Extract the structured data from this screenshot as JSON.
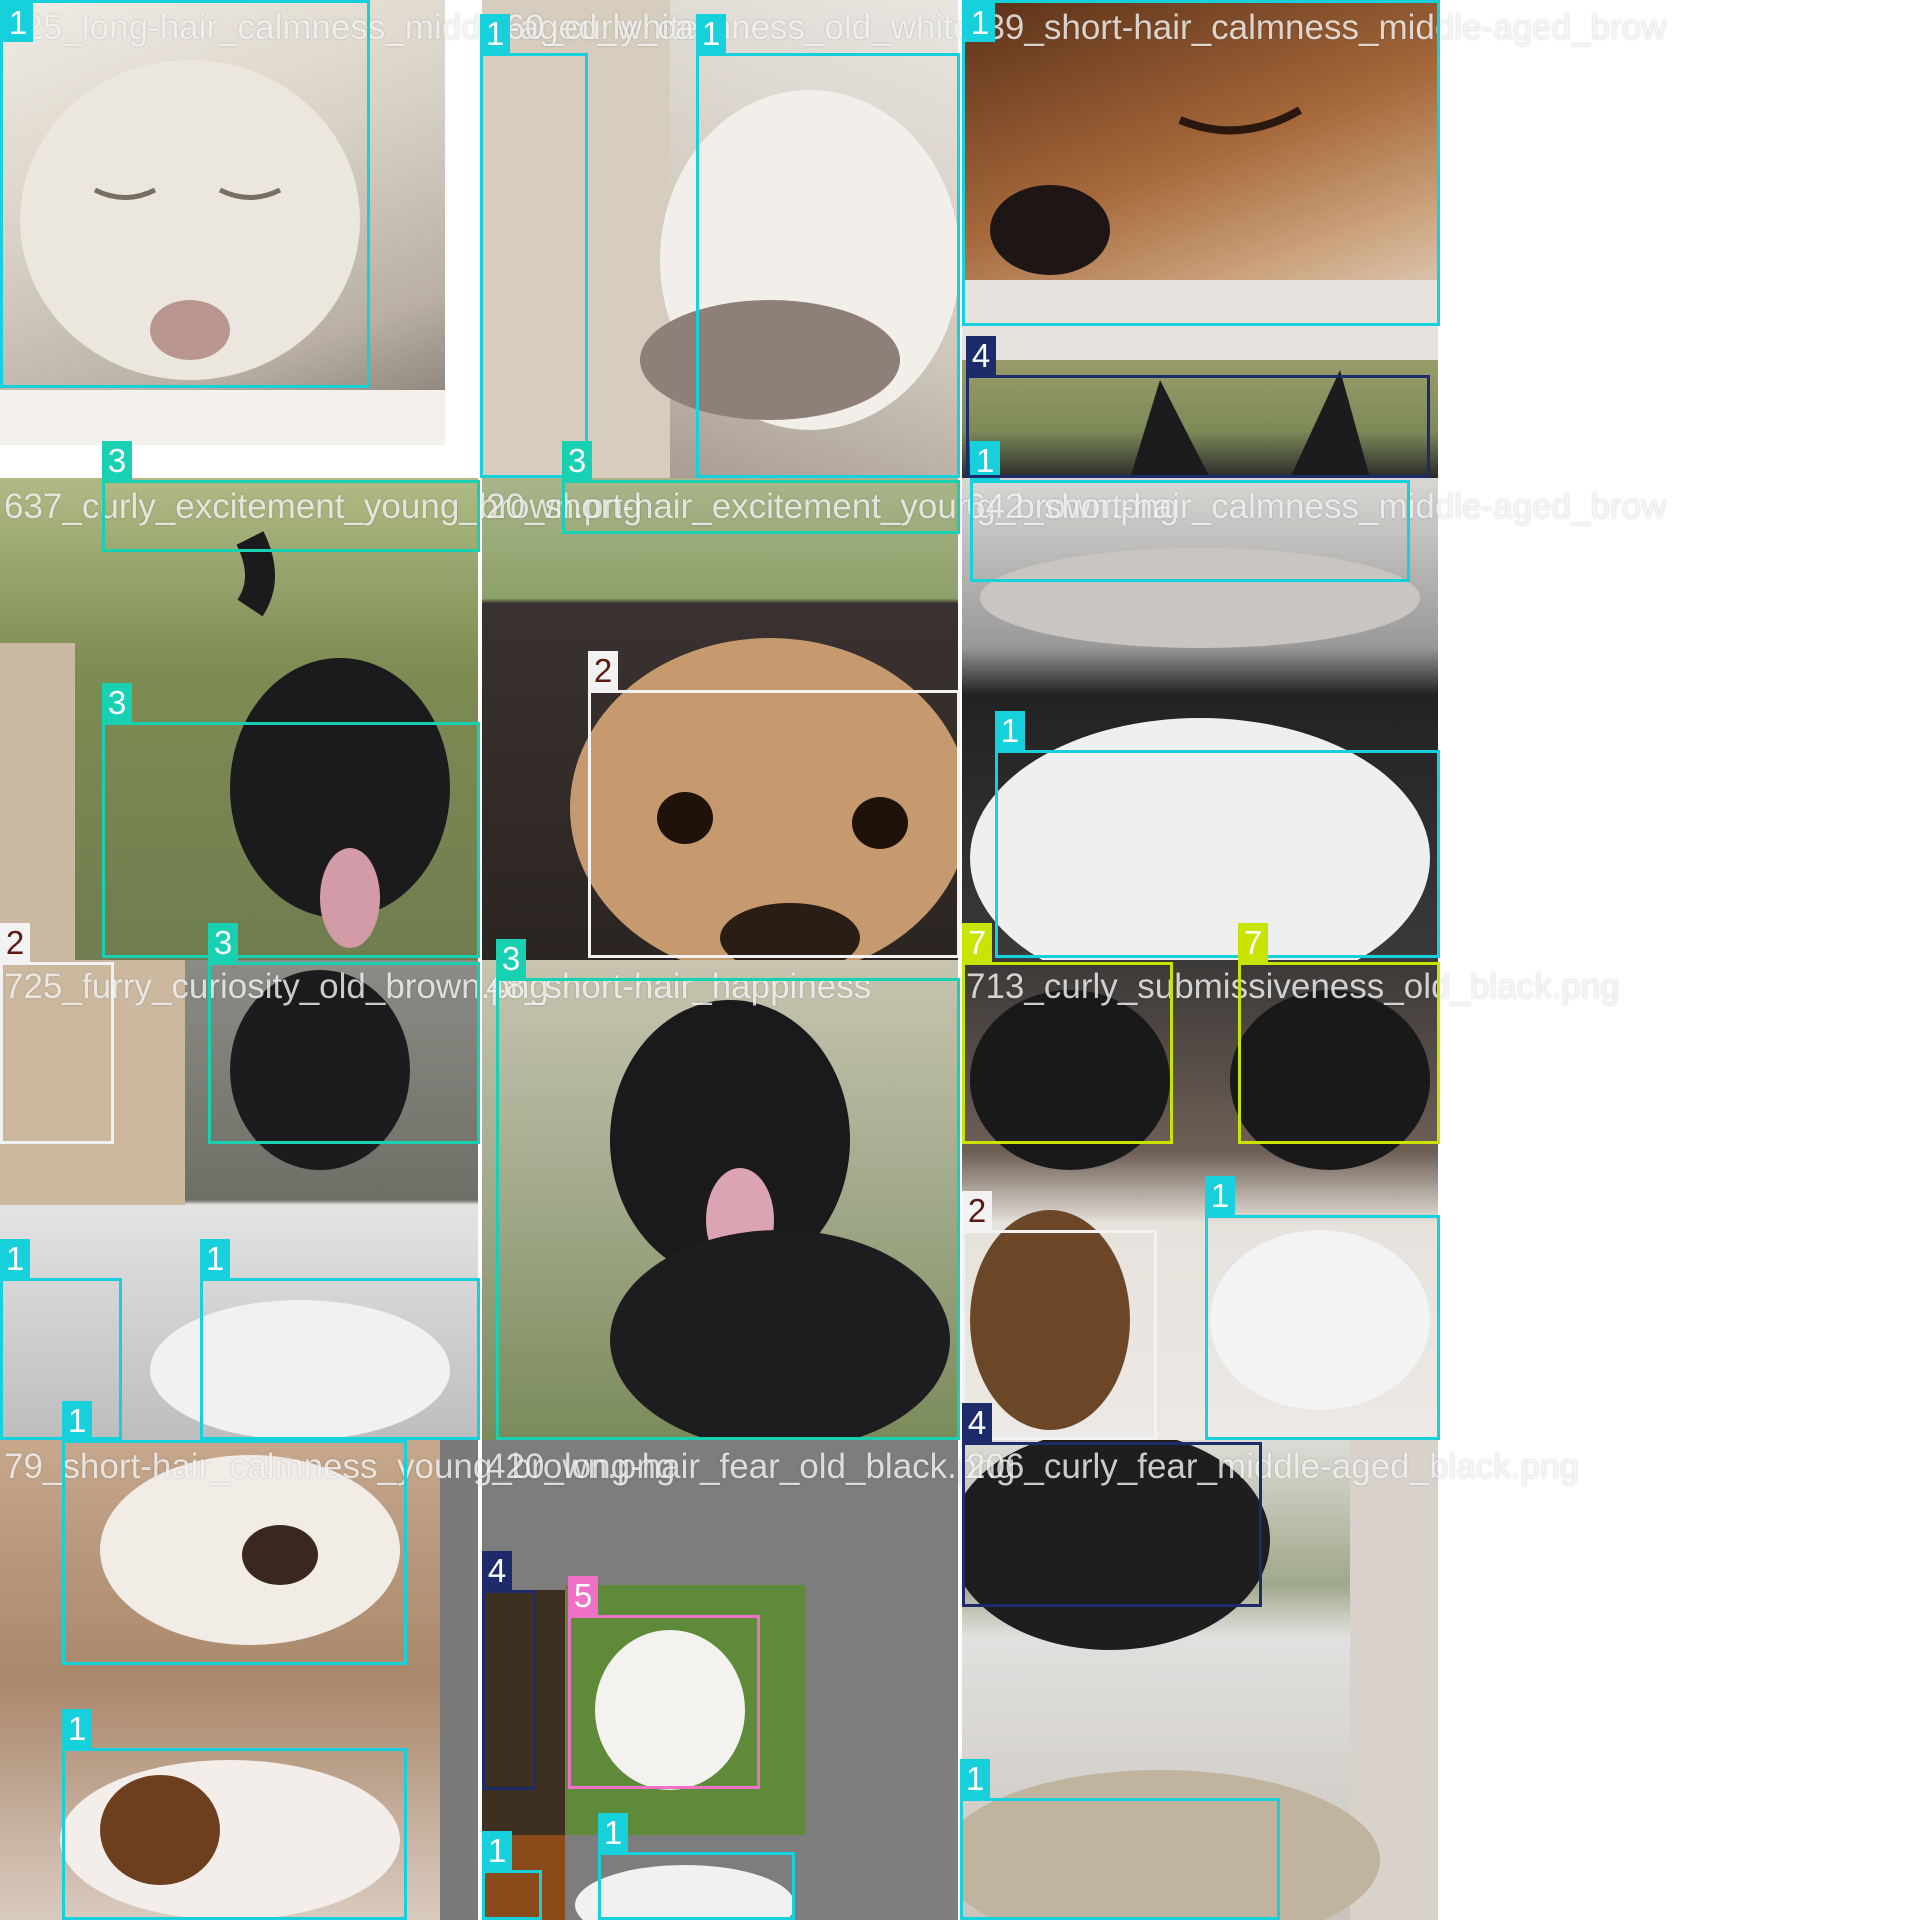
{
  "captions": [
    "725_long-hair_calmness_middle-aged_white",
    "160_curly_calmness_old_white",
    "139_short-hair_calmness_middle-aged_brow",
    "637_curly_excitement_young_brown.png",
    "20_short-hair_excitement_young_brown.png",
    "642_short-hair_calmness_middle-aged_brow",
    "725_furry_curiosity_old_brown.png",
    "48_short-hair_happiness",
    "713_curly_submissiveness_old_black.png",
    "79_short-hair_calmness_young_brown.png",
    "420_long-hair_fear_old_black.png",
    "206_curly_fear_middle-aged_black.png"
  ],
  "labels": {
    "one": "1",
    "two": "2",
    "three": "3",
    "four": "4",
    "five": "5",
    "seven": "7"
  },
  "colors": {
    "class_1": "#16d0dc",
    "class_2": "#f2f2f2",
    "class_3": "#18d1b3",
    "class_4": "#1d2b6b",
    "class_5": "#f070c8",
    "class_7": "#c8e400"
  }
}
